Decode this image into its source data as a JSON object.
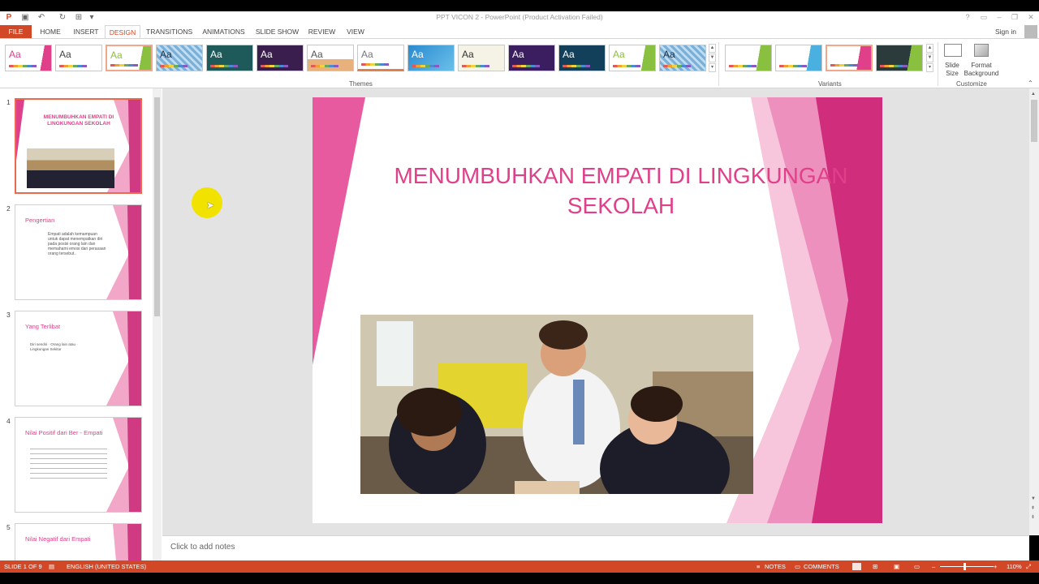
{
  "window": {
    "title": "PPT VICON 2 - PowerPoint (Product Activation Failed)",
    "sign_in": "Sign in"
  },
  "tabs": [
    {
      "label": "FILE"
    },
    {
      "label": "HOME"
    },
    {
      "label": "INSERT"
    },
    {
      "label": "DESIGN"
    },
    {
      "label": "TRANSITIONS"
    },
    {
      "label": "ANIMATIONS"
    },
    {
      "label": "SLIDE SHOW"
    },
    {
      "label": "REVIEW"
    },
    {
      "label": "VIEW"
    }
  ],
  "ribbon": {
    "theme_sample": "Aa",
    "themes_label": "Themes",
    "variants_label": "Variants",
    "customize_label": "Customize",
    "slide_size_label": "Slide Size",
    "format_background_label": "Format Background"
  },
  "slides": [
    {
      "num": "1",
      "title": "MENUMBUHKAN EMPATI DI LINGKUNGAN SEKOLAH"
    },
    {
      "num": "2",
      "title": "Pengertian",
      "body": "Empati adalah kemampuan untuk dapat menempatkan diri pada posisi orang lain dan memahami emosi dari perasaan orang tersebut.."
    },
    {
      "num": "3",
      "title": "Yang Terlibat",
      "body": "Diri sendiri · Orang lain atau · Lingkungan Sekitar"
    },
    {
      "num": "4",
      "title": "Nilai Positif dari Ber - Empati"
    },
    {
      "num": "5",
      "title": "Nilai Negatif dari Empati"
    }
  ],
  "current_slide": {
    "title_line1": "MENUMBUHKAN EMPATI DI LINGKUNGAN",
    "title_line2": "SEKOLAH"
  },
  "notes_placeholder": "Click to add notes",
  "status": {
    "slide": "SLIDE 1 OF 9",
    "language": "ENGLISH (UNITED STATES)",
    "notes": "NOTES",
    "comments": "COMMENTS",
    "zoom": "110%"
  },
  "colors": {
    "accent": "#d24726",
    "slide_pink": "#e0408a"
  }
}
